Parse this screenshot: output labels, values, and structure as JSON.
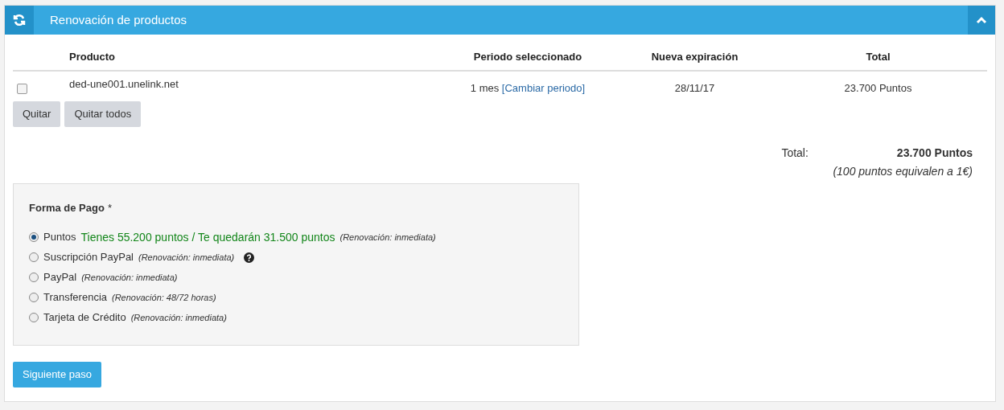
{
  "panel": {
    "title": "Renovación de productos",
    "expanded": true
  },
  "table": {
    "columns": [
      "Producto",
      "Periodo seleccionado",
      "Nueva expiración",
      "Total"
    ],
    "rows": [
      {
        "checked": false,
        "product": "ded-une001.unelink.net",
        "period": "1 mes",
        "period_link": "[Cambiar periodo]",
        "expiration": "28/11/17",
        "total": "23.700 Puntos"
      }
    ]
  },
  "buttons": [
    "Quitar",
    "Quitar todos"
  ],
  "summary": {
    "label": "Total:",
    "value": "23.700 Puntos",
    "note": "(100 puntos equivalen a 1€)"
  },
  "payment": {
    "title": "Forma de Pago",
    "required": "*",
    "options": [
      {
        "label": "Puntos",
        "detail": "Tienes 55.200 puntos / Te quedarán 31.500 puntos",
        "note": "(Renovación: inmediata)",
        "help": false,
        "selected": true
      },
      {
        "label": "Suscripción PayPal",
        "note": "(Renovación: inmediata)",
        "help": true,
        "selected": false
      },
      {
        "label": "PayPal",
        "note": "(Renovación: inmediata)",
        "help": false,
        "selected": false
      },
      {
        "label": "Transferencia",
        "note": "(Renovación: 48/72 horas)",
        "help": false,
        "selected": false
      },
      {
        "label": "Tarjeta de Crédito",
        "note": "(Renovación: inmediata)",
        "help": false,
        "selected": false
      }
    ]
  },
  "next_button": "Siguiente paso"
}
